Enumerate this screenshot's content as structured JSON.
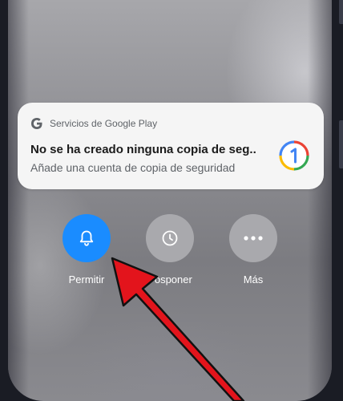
{
  "notification": {
    "app_name": "Servicios de Google Play",
    "title": "No se ha creado ninguna copia de seg..",
    "text": "Añade una cuenta de copia de seguridad",
    "app_icon": "google-g-icon",
    "large_icon": "google-one-icon"
  },
  "actions": [
    {
      "label": "Permitir",
      "icon": "bell-icon",
      "color": "#1a8cff"
    },
    {
      "label": "Posponer",
      "icon": "clock-icon",
      "color": "#a9a9ad"
    },
    {
      "label": "Más",
      "icon": "more-icon",
      "color": "#a9a9ad"
    }
  ],
  "colors": {
    "accent_blue": "#1a8cff",
    "arrow_red": "#e3141c"
  }
}
